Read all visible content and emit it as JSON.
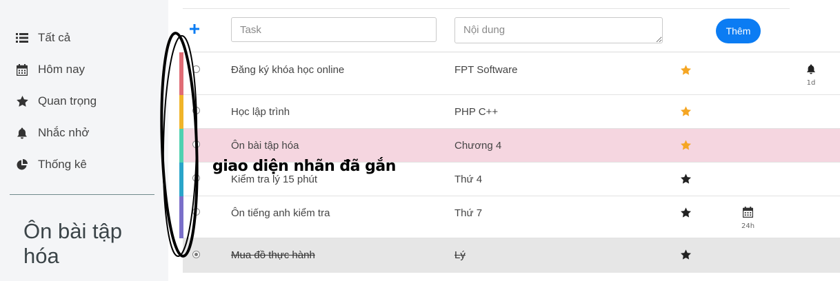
{
  "sidebar": {
    "items": [
      {
        "label": "Tất cả",
        "icon": "list-icon"
      },
      {
        "label": "Hôm nay",
        "icon": "calendar-icon"
      },
      {
        "label": "Quan trọng",
        "icon": "star-icon"
      },
      {
        "label": "Nhắc nhở",
        "icon": "bell-icon"
      },
      {
        "label": "Thống kê",
        "icon": "pie-chart-icon"
      }
    ],
    "current_list_title": "Ôn bài tập hóa"
  },
  "form": {
    "task_placeholder": "Task",
    "content_placeholder": "Nội dung",
    "add_button": "Thêm"
  },
  "tasks": [
    {
      "title": "Đăng ký khóa học online",
      "content": "FPT Software",
      "important": true,
      "star_color": "#f5a623",
      "reminder": "1d",
      "label_color": "#e06c75",
      "highlight": "none",
      "done": false
    },
    {
      "title": "Học lập trình",
      "content": "PHP C++",
      "important": true,
      "star_color": "#f5a623",
      "label_color": "#f0b429",
      "highlight": "none",
      "done": false
    },
    {
      "title": "Ôn bài tập hóa",
      "content": "Chương 4",
      "important": true,
      "star_color": "#f5a623",
      "label_color": "#4fd1b0",
      "highlight": "pink",
      "done": false
    },
    {
      "title": "Kiểm tra lý 15 phút",
      "content": "Thứ 4",
      "important": false,
      "star_color": "#222222",
      "label_color": "#2aa5c9",
      "highlight": "none",
      "done": false
    },
    {
      "title": "Ôn tiếng anh kiểm tra",
      "content": "Thứ 7",
      "important": false,
      "star_color": "#222222",
      "due": "24h",
      "label_color": "#7a6fc9",
      "highlight": "none",
      "done": false
    },
    {
      "title": "Mua đồ thực hành",
      "content": "Lý",
      "important": false,
      "star_color": "#222222",
      "label_color": "",
      "highlight": "gray",
      "done": true
    }
  ],
  "annotation": {
    "text": "giao diện nhãn đã gắn"
  },
  "colors": {
    "accent": "#0b7cf3",
    "sidebar_bg": "#f4f5f7",
    "star_important": "#f5a623"
  }
}
